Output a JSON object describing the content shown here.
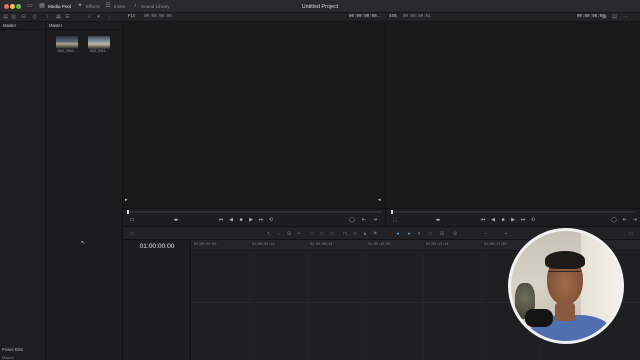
{
  "titlebar": {
    "project_title": "Untitled Project",
    "tabs": [
      {
        "label": "Media Pool",
        "icon": "media-pool-icon",
        "active": true
      },
      {
        "label": "Effects",
        "icon": "effects-icon",
        "active": false
      },
      {
        "label": "Index",
        "icon": "index-icon",
        "active": false
      },
      {
        "label": "Sound Library",
        "icon": "sound-library-icon",
        "active": false
      }
    ]
  },
  "toolbar": {
    "fit_label": "Fit",
    "source_timecode": "00:00:00:00",
    "source_duration": "00:00:00:00",
    "zoom_percent": "45%",
    "timeline_timecode": "00:00:00:01",
    "timeline_name_timecode": "00:00:00:00"
  },
  "bins": {
    "header": "Master",
    "power_bins_label": "Power Bins",
    "power_master_label": "Master"
  },
  "media_pool": {
    "header": "Master",
    "clips": [
      {
        "name": "IMG_0910..."
      },
      {
        "name": "IMG_0911..."
      }
    ]
  },
  "timeline": {
    "timecode": "01:00:00:00",
    "ruler_labels": [
      "01:00:00:00",
      "01:00:03:12",
      "01:00:06:24",
      "01:00:10:06",
      "01:00:13:18",
      "01:00:17:00",
      "01:00:20:12"
    ]
  },
  "colors": {
    "accent_blue": "#4f8cd6",
    "zoom_green": "#4c8f3e",
    "title_bar": "#2a2a2d"
  }
}
